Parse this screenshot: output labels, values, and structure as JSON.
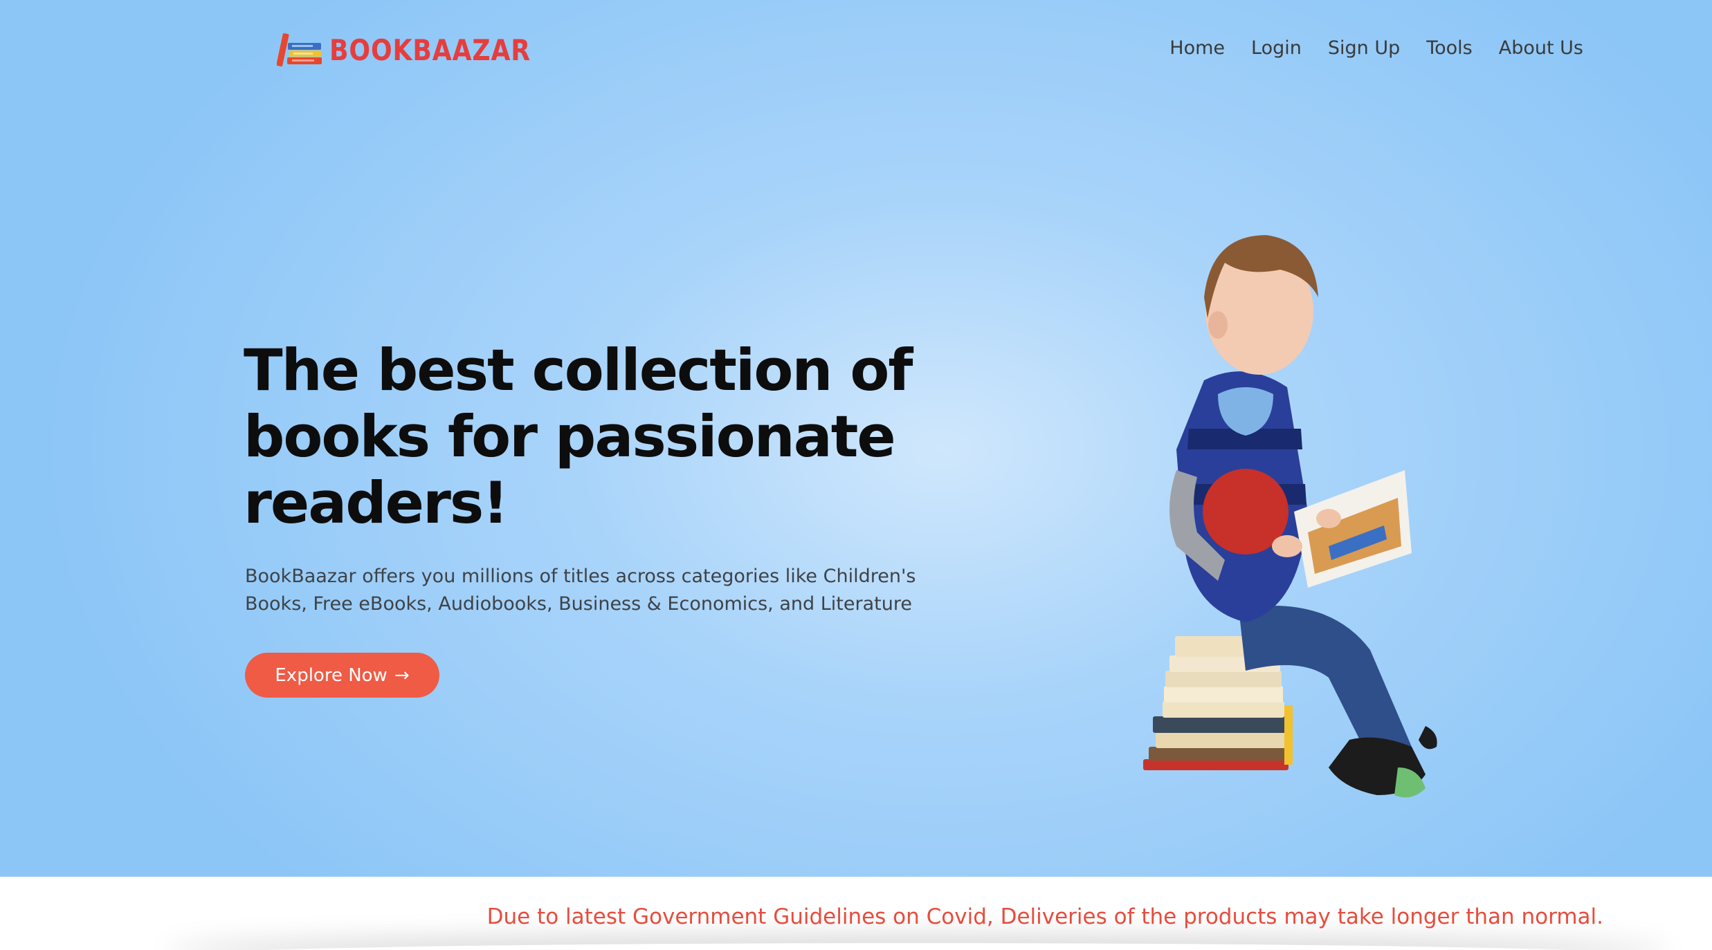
{
  "brand": {
    "name": "BOOKBAAZAR",
    "logo_icon": "books-logo-icon",
    "accent_color": "#e63d3d"
  },
  "nav": {
    "items": [
      {
        "label": "Home"
      },
      {
        "label": "Login"
      },
      {
        "label": "Sign Up"
      },
      {
        "label": "Tools"
      },
      {
        "label": "About Us"
      }
    ]
  },
  "hero": {
    "headline": "The best collection of books for passionate readers!",
    "description": "BookBaazar offers you millions of titles across categories like Children's Books, Free eBooks, Audiobooks, Business & Economics, and Literature",
    "cta_label": "Explore Now",
    "cta_icon": "arrow-right-icon",
    "cta_arrow": "→",
    "cta_color": "#ef5b45",
    "illustration": "child-reading-on-books-image"
  },
  "notice": {
    "text": "Due to latest Government Guidelines on Covid, Deliveries of the products may take longer than normal.",
    "color": "#e74c3c"
  }
}
